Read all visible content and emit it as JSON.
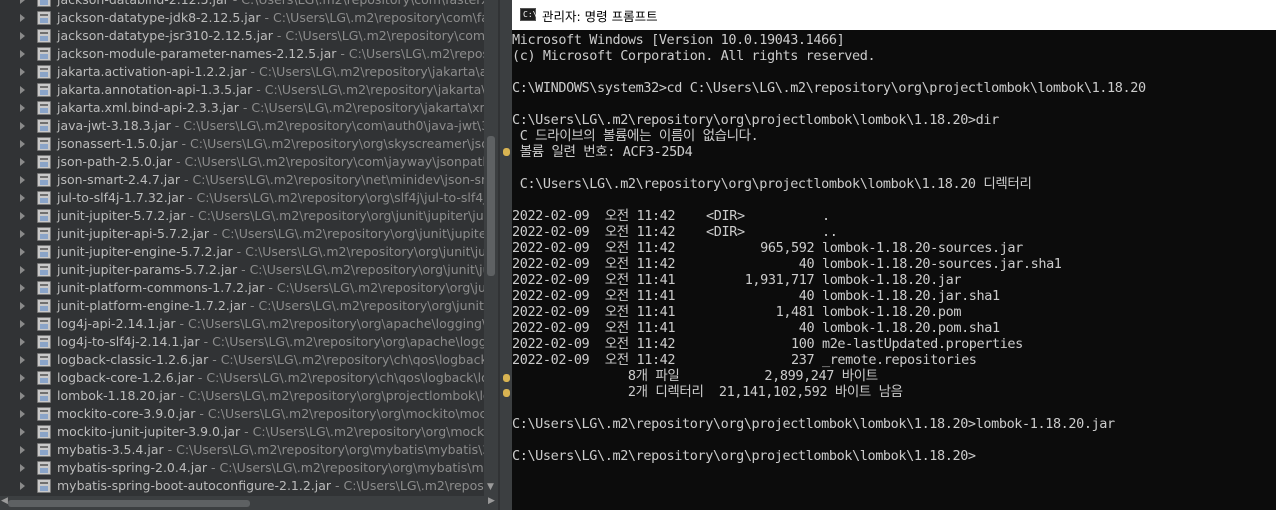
{
  "explorer": {
    "items": [
      {
        "name": "jackson-databind-2.12.5.jar",
        "path": "C:\\Users\\LG\\.m2\\repository\\com\\fasterxml\\"
      },
      {
        "name": "jackson-datatype-jdk8-2.12.5.jar",
        "path": "C:\\Users\\LG\\.m2\\repository\\com\\fasterx"
      },
      {
        "name": "jackson-datatype-jsr310-2.12.5.jar",
        "path": "C:\\Users\\LG\\.m2\\repository\\com\\faste"
      },
      {
        "name": "jackson-module-parameter-names-2.12.5.jar",
        "path": "C:\\Users\\LG\\.m2\\repository\\c"
      },
      {
        "name": "jakarta.activation-api-1.2.2.jar",
        "path": "C:\\Users\\LG\\.m2\\repository\\jakarta\\activat"
      },
      {
        "name": "jakarta.annotation-api-1.3.5.jar",
        "path": "C:\\Users\\LG\\.m2\\repository\\jakarta\\annot"
      },
      {
        "name": "jakarta.xml.bind-api-2.3.3.jar",
        "path": "C:\\Users\\LG\\.m2\\repository\\jakarta\\xml\\bin"
      },
      {
        "name": "java-jwt-3.18.3.jar",
        "path": "C:\\Users\\LG\\.m2\\repository\\com\\auth0\\java-jwt\\3.1"
      },
      {
        "name": "jsonassert-1.5.0.jar",
        "path": "C:\\Users\\LG\\.m2\\repository\\org\\skyscreamer\\jsonass"
      },
      {
        "name": "json-path-2.5.0.jar",
        "path": "C:\\Users\\LG\\.m2\\repository\\com\\jayway\\jsonpath\\js"
      },
      {
        "name": "json-smart-2.4.7.jar",
        "path": "C:\\Users\\LG\\.m2\\repository\\net\\minidev\\json-smart"
      },
      {
        "name": "jul-to-slf4j-1.7.32.jar",
        "path": "C:\\Users\\LG\\.m2\\repository\\org\\slf4j\\jul-to-slf4j\\1"
      },
      {
        "name": "junit-jupiter-5.7.2.jar",
        "path": "C:\\Users\\LG\\.m2\\repository\\org\\junit\\jupiter\\juni"
      },
      {
        "name": "junit-jupiter-api-5.7.2.jar",
        "path": "C:\\Users\\LG\\.m2\\repository\\org\\junit\\jupiter\\j"
      },
      {
        "name": "junit-jupiter-engine-5.7.2.jar",
        "path": "C:\\Users\\LG\\.m2\\repository\\org\\junit\\jupite"
      },
      {
        "name": "junit-jupiter-params-5.7.2.jar",
        "path": "C:\\Users\\LG\\.m2\\repository\\org\\junit\\jupit"
      },
      {
        "name": "junit-platform-commons-1.7.2.jar",
        "path": "C:\\Users\\LG\\.m2\\repository\\org\\junit\\pl"
      },
      {
        "name": "junit-platform-engine-1.7.2.jar",
        "path": "C:\\Users\\LG\\.m2\\repository\\org\\junit\\pla"
      },
      {
        "name": "log4j-api-2.14.1.jar",
        "path": "C:\\Users\\LG\\.m2\\repository\\org\\apache\\logging\\log"
      },
      {
        "name": "log4j-to-slf4j-2.14.1.jar",
        "path": "C:\\Users\\LG\\.m2\\repository\\org\\apache\\logging"
      },
      {
        "name": "logback-classic-1.2.6.jar",
        "path": "C:\\Users\\LG\\.m2\\repository\\ch\\qos\\logback\\log"
      },
      {
        "name": "logback-core-1.2.6.jar",
        "path": "C:\\Users\\LG\\.m2\\repository\\ch\\qos\\logback\\logb"
      },
      {
        "name": "lombok-1.18.20.jar",
        "path": "C:\\Users\\LG\\.m2\\repository\\org\\projectlombok\\lom"
      },
      {
        "name": "mockito-core-3.9.0.jar",
        "path": "C:\\Users\\LG\\.m2\\repository\\org\\mockito\\mockito"
      },
      {
        "name": "mockito-junit-jupiter-3.9.0.jar",
        "path": "C:\\Users\\LG\\.m2\\repository\\org\\mockito\\"
      },
      {
        "name": "mybatis-3.5.4.jar",
        "path": "C:\\Users\\LG\\.m2\\repository\\org\\mybatis\\mybatis\\3.5."
      },
      {
        "name": "mybatis-spring-2.0.4.jar",
        "path": "C:\\Users\\LG\\.m2\\repository\\org\\mybatis\\mybat"
      },
      {
        "name": "mybatis-spring-boot-autoconfigure-2.1.2.jar",
        "path": "C:\\Users\\LG\\.m2\\repository\\o"
      }
    ]
  },
  "cmd": {
    "title": "관리자: 명령 프롬프트",
    "icon": "cmd-icon",
    "lines": [
      "Microsoft Windows [Version 10.0.19043.1466]",
      "(c) Microsoft Corporation. All rights reserved.",
      "",
      "C:\\WINDOWS\\system32>cd C:\\Users\\LG\\.m2\\repository\\org\\projectlombok\\lombok\\1.18.20",
      "",
      "C:\\Users\\LG\\.m2\\repository\\org\\projectlombok\\lombok\\1.18.20>dir",
      " C 드라이브의 볼륨에는 이름이 없습니다.",
      " 볼륨 일련 번호: ACF3-25D4",
      "",
      " C:\\Users\\LG\\.m2\\repository\\org\\projectlombok\\lombok\\1.18.20 디렉터리",
      "",
      "2022-02-09  오전 11:42    <DIR>          .",
      "2022-02-09  오전 11:42    <DIR>          ..",
      "2022-02-09  오전 11:42           965,592 lombok-1.18.20-sources.jar",
      "2022-02-09  오전 11:42                40 lombok-1.18.20-sources.jar.sha1",
      "2022-02-09  오전 11:41         1,931,717 lombok-1.18.20.jar",
      "2022-02-09  오전 11:41                40 lombok-1.18.20.jar.sha1",
      "2022-02-09  오전 11:41             1,481 lombok-1.18.20.pom",
      "2022-02-09  오전 11:41                40 lombok-1.18.20.pom.sha1",
      "2022-02-09  오전 11:42               100 m2e-lastUpdated.properties",
      "2022-02-09  오전 11:42               237 _remote.repositories",
      "               8개 파일           2,899,247 바이트",
      "               2개 디렉터리  21,141,102,592 바이트 남음",
      "",
      "C:\\Users\\LG\\.m2\\repository\\org\\projectlombok\\lombok\\1.18.20>lombok-1.18.20.jar",
      "",
      "C:\\Users\\LG\\.m2\\repository\\org\\projectlombok\\lombok\\1.18.20>"
    ]
  }
}
